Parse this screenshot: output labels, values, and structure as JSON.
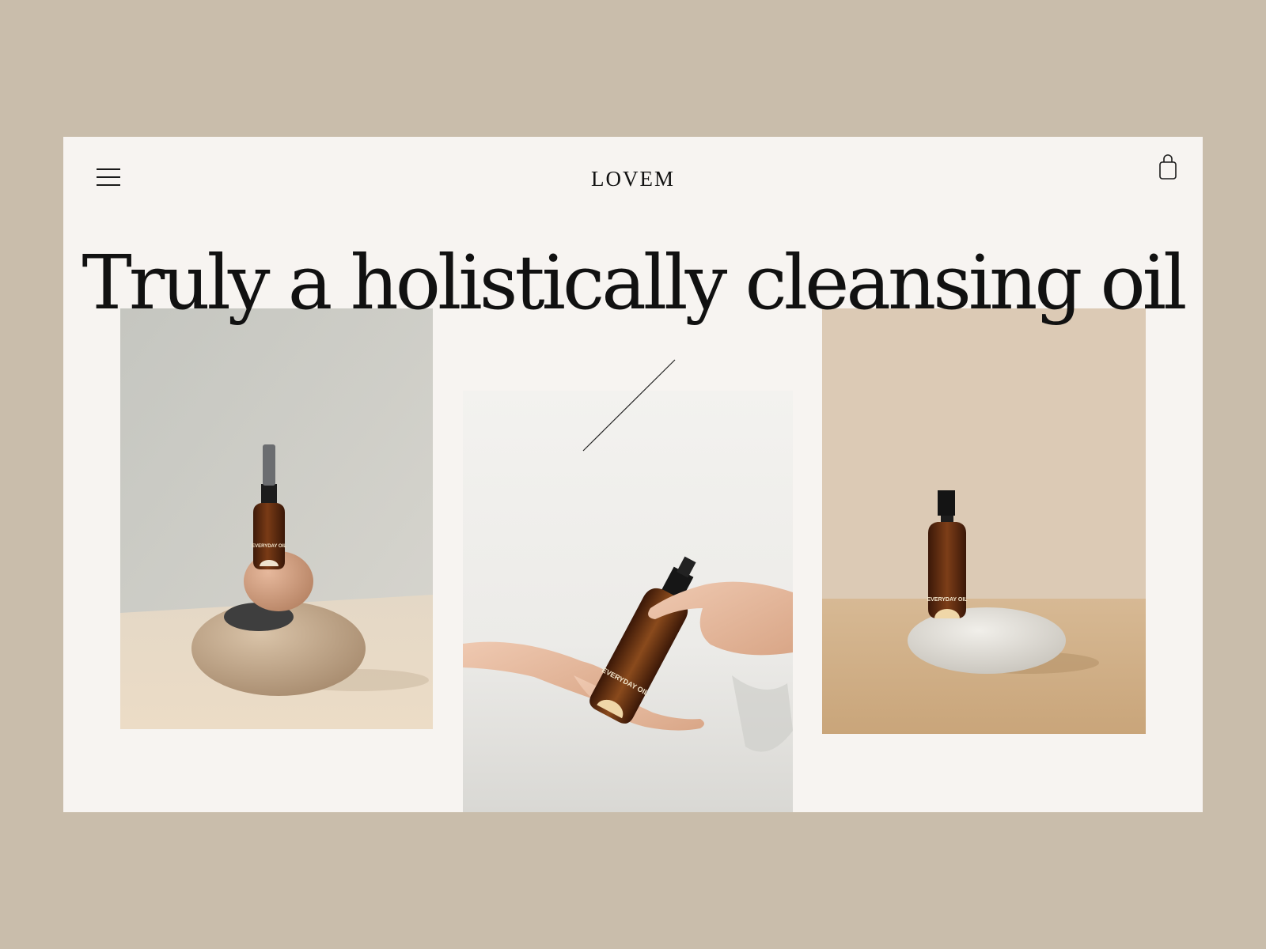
{
  "brand": {
    "logo": "LOVEM"
  },
  "header": {
    "menu_icon": "hamburger-menu-icon",
    "cart_icon": "shopping-bag-icon"
  },
  "hero": {
    "headline": "Truly a holistically cleansing oil"
  },
  "products": [
    {
      "label": "EVERYDAY OIL"
    },
    {
      "label": "EVERYDAY OIL"
    },
    {
      "label": "EVERYDAY OIL"
    }
  ],
  "colors": {
    "page_background": "#c9bdab",
    "frame_background": "#f7f4f1",
    "text": "#111111",
    "amber_bottle": "#5a2d14"
  }
}
